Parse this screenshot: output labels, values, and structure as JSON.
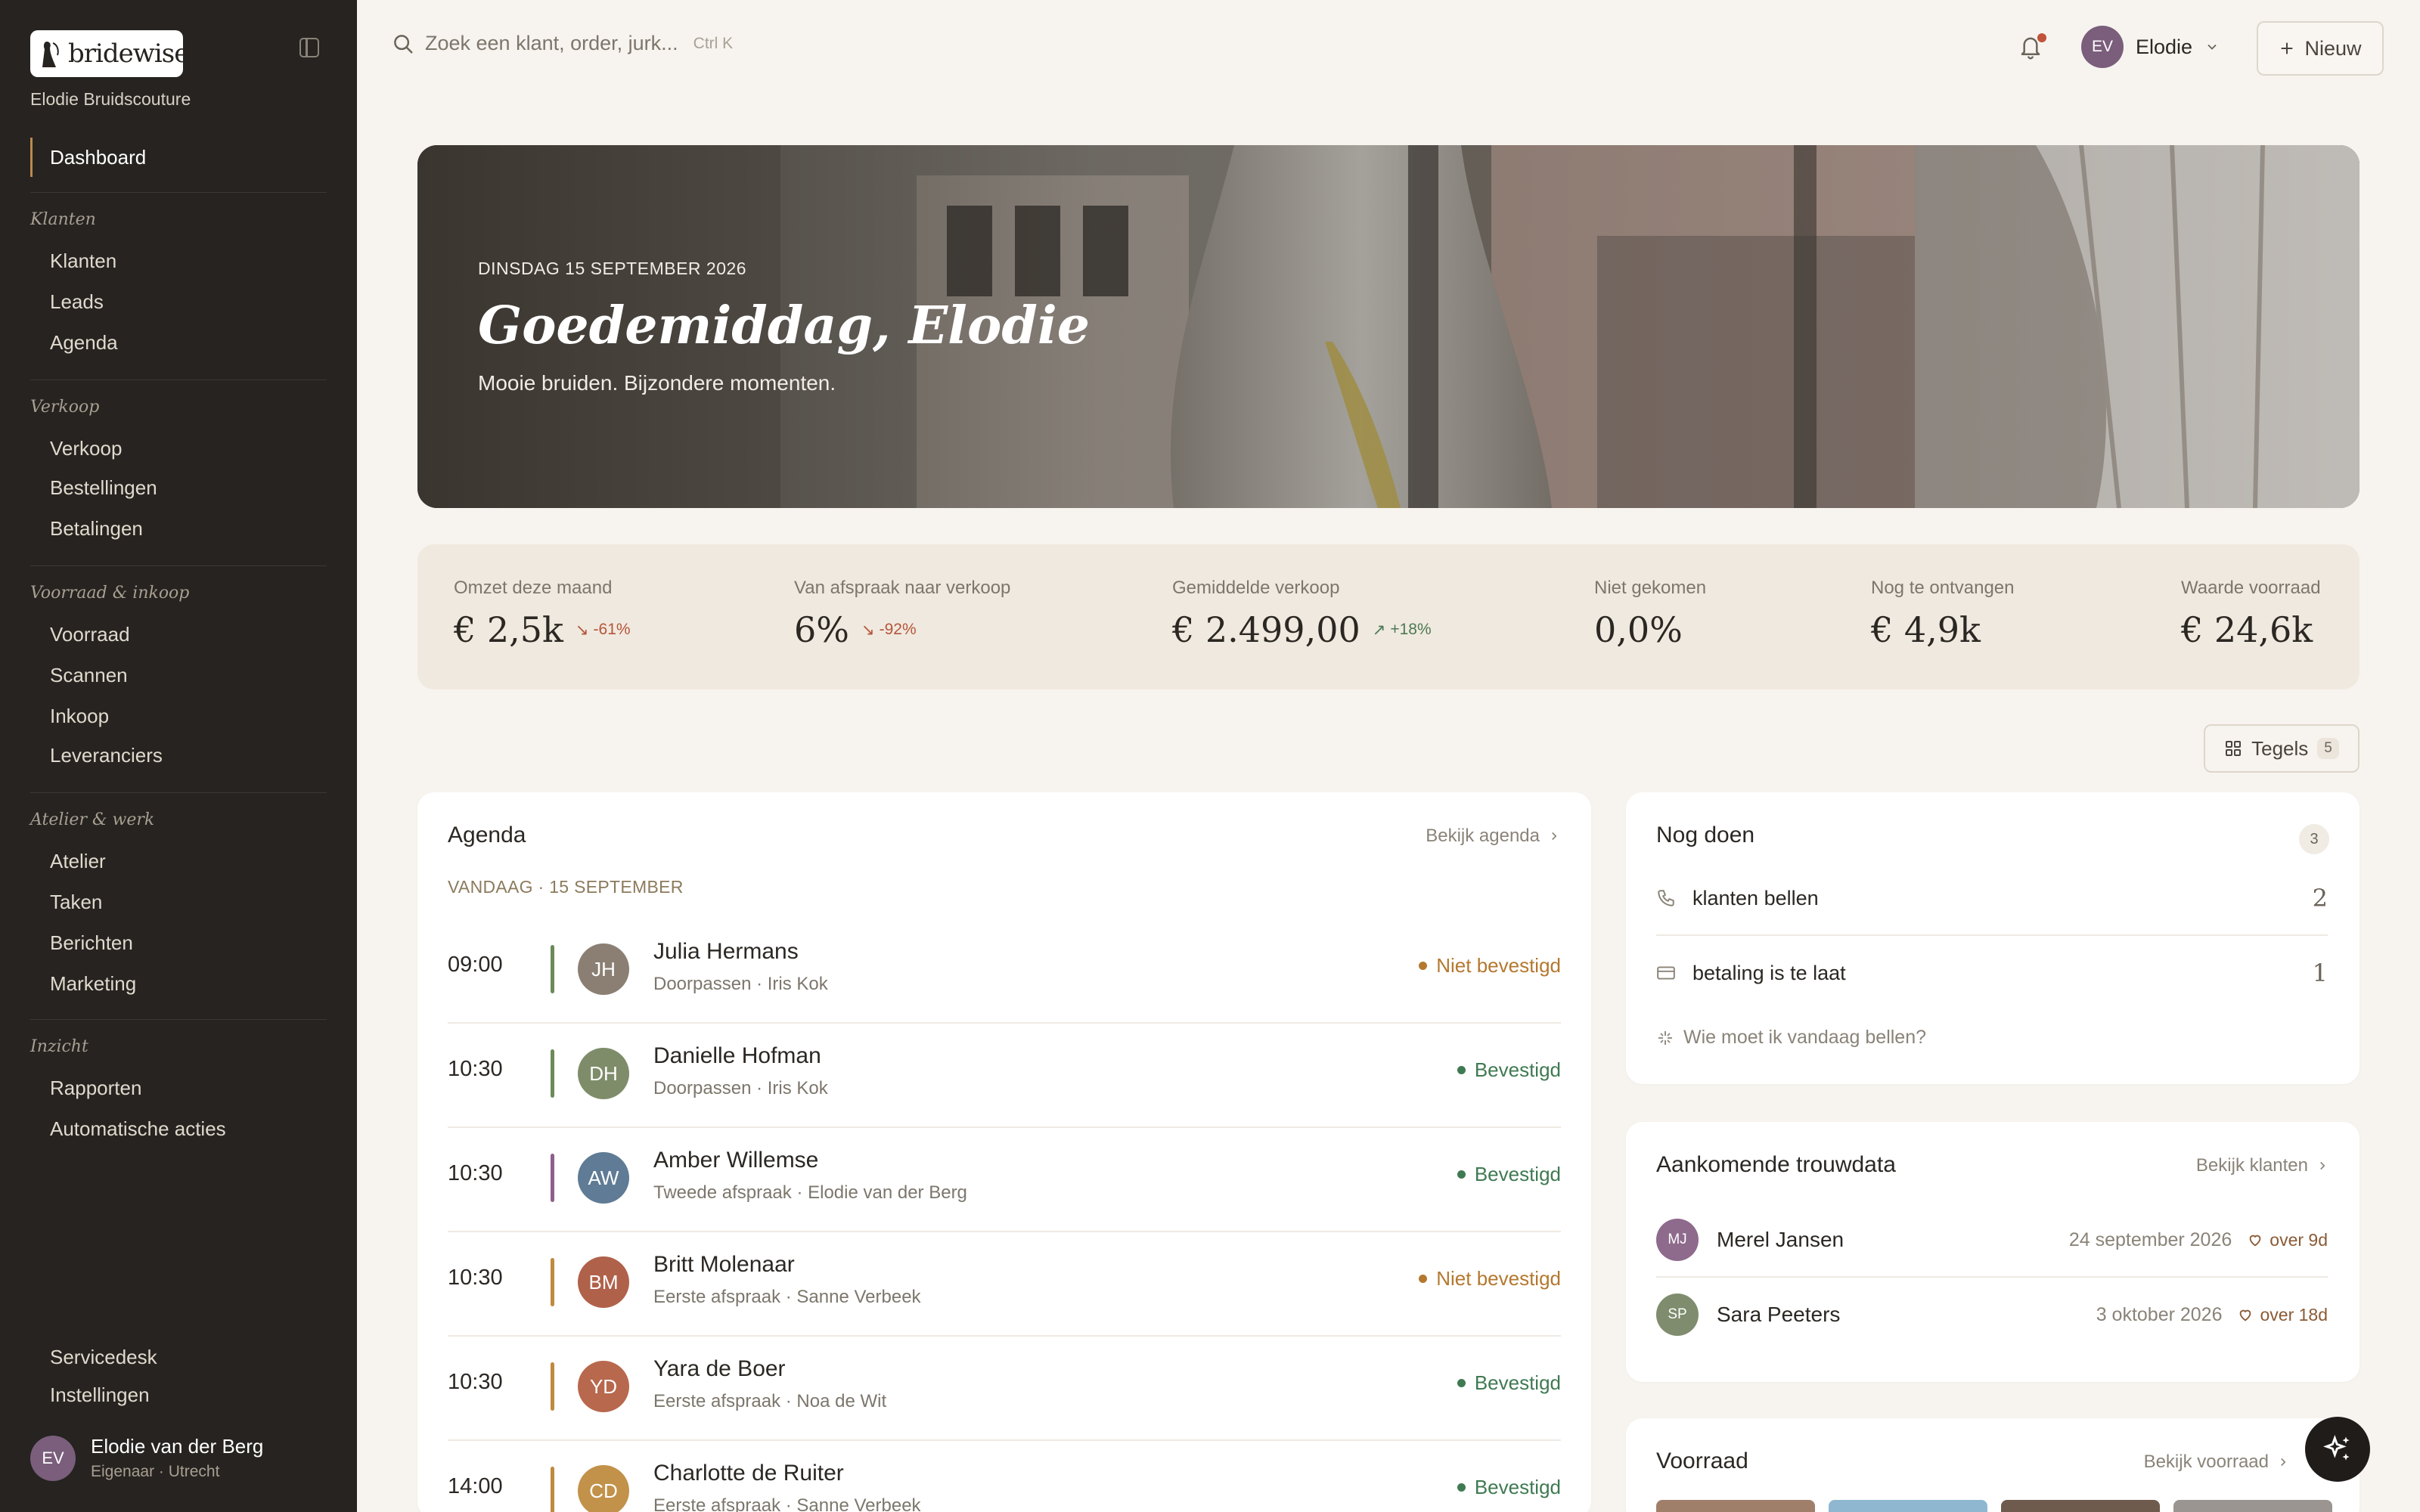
{
  "brand": {
    "name": "bridewise",
    "store": "Elodie Bruidscouture"
  },
  "sidebar": {
    "active": "Dashboard",
    "groups": [
      {
        "title": "Klanten",
        "items": [
          "Klanten",
          "Leads",
          "Agenda"
        ]
      },
      {
        "title": "Verkoop",
        "items": [
          "Verkoop",
          "Bestellingen",
          "Betalingen"
        ]
      },
      {
        "title": "Voorraad & inkoop",
        "items": [
          "Voorraad",
          "Scannen",
          "Inkoop",
          "Leveranciers"
        ]
      },
      {
        "title": "Atelier & werk",
        "items": [
          "Atelier",
          "Taken",
          "Berichten",
          "Marketing"
        ]
      },
      {
        "title": "Inzicht",
        "items": [
          "Rapporten",
          "Automatische acties"
        ]
      }
    ],
    "footer_items": [
      "Servicedesk",
      "Instellingen"
    ],
    "user": {
      "initials": "EV",
      "name": "Elodie van der Berg",
      "role": "Eigenaar · Utrecht"
    }
  },
  "topbar": {
    "search_placeholder": "Zoek een klant, order, jurk...",
    "search_shortcut": "Ctrl K",
    "user_initials": "EV",
    "user_name": "Elodie",
    "new_label": "Nieuw"
  },
  "hero": {
    "date": "DINSDAG 15 SEPTEMBER 2026",
    "greeting": "Goedemiddag, Elodie",
    "tagline": "Mooie bruiden. Bijzondere momenten."
  },
  "kpis": [
    {
      "label": "Omzet deze maand",
      "value": "€ 2,5k",
      "delta": "-61%",
      "trend": "down"
    },
    {
      "label": "Van afspraak naar verkoop",
      "value": "6%",
      "delta": "-92%",
      "trend": "down"
    },
    {
      "label": "Gemiddelde verkoop",
      "value": "€ 2.499,00",
      "delta": "+18%",
      "trend": "up"
    },
    {
      "label": "Niet gekomen",
      "value": "0,0%",
      "delta": "",
      "trend": ""
    },
    {
      "label": "Nog te ontvangen",
      "value": "€ 4,9k",
      "delta": "",
      "trend": ""
    },
    {
      "label": "Waarde voorraad",
      "value": "€ 24,6k",
      "delta": "",
      "trend": ""
    }
  ],
  "tiles": {
    "label": "Tegels",
    "count": "5"
  },
  "agenda": {
    "title": "Agenda",
    "link": "Bekijk agenda",
    "day_label": "VANDAAG · 15 SEPTEMBER",
    "appointments": [
      {
        "time": "09:00",
        "initials": "JH",
        "name": "Julia Hermans",
        "sub": "Doorpassen · Iris Kok",
        "status": "Niet bevestigd",
        "bar": "#6b8a5a",
        "avatar": "#8b7f73",
        "statusColor": "#b4782f"
      },
      {
        "time": "10:30",
        "initials": "DH",
        "name": "Danielle Hofman",
        "sub": "Doorpassen · Iris Kok",
        "status": "Bevestigd",
        "bar": "#6b8a5a",
        "avatar": "#7e8c6a",
        "statusColor": "#3f7a52"
      },
      {
        "time": "10:30",
        "initials": "AW",
        "name": "Amber Willemse",
        "sub": "Tweede afspraak · Elodie van der Berg",
        "status": "Bevestigd",
        "bar": "#8e5f8c",
        "avatar": "#5f7b95",
        "statusColor": "#3f7a52"
      },
      {
        "time": "10:30",
        "initials": "BM",
        "name": "Britt Molenaar",
        "sub": "Eerste afspraak · Sanne Verbeek",
        "status": "Niet bevestigd",
        "bar": "#c08a3e",
        "avatar": "#b0614a",
        "statusColor": "#b4782f"
      },
      {
        "time": "10:30",
        "initials": "YD",
        "name": "Yara de Boer",
        "sub": "Eerste afspraak · Noa de Wit",
        "status": "Bevestigd",
        "bar": "#c08a3e",
        "avatar": "#b8684d",
        "statusColor": "#3f7a52"
      },
      {
        "time": "14:00",
        "initials": "CD",
        "name": "Charlotte de Ruiter",
        "sub": "Eerste afspraak · Sanne Verbeek",
        "status": "Bevestigd",
        "bar": "#c08a3e",
        "avatar": "#c2924a",
        "statusColor": "#3f7a52"
      }
    ]
  },
  "todo": {
    "title": "Nog doen",
    "count": "3",
    "items": [
      {
        "icon": "phone-icon",
        "label": "klanten bellen",
        "count": "2"
      },
      {
        "icon": "card-icon",
        "label": "betaling is te laat",
        "count": "1"
      }
    ],
    "ai_prompt": "Wie moet ik vandaag bellen?"
  },
  "weddings": {
    "title": "Aankomende trouwdata",
    "link": "Bekijk klanten",
    "items": [
      {
        "initials": "MJ",
        "name": "Merel Jansen",
        "date": "24 september 2026",
        "badge": "over 9d",
        "color": "#8e6a8c"
      },
      {
        "initials": "SP",
        "name": "Sara Peeters",
        "date": "3 oktober 2026",
        "badge": "over 18d",
        "color": "#7f8c6e"
      }
    ]
  },
  "inventory": {
    "title": "Voorraad",
    "link": "Bekijk voorraad"
  },
  "colors": {
    "sidebar": "#262320",
    "accent": "#b98a4f",
    "background": "#f7f4ef"
  }
}
